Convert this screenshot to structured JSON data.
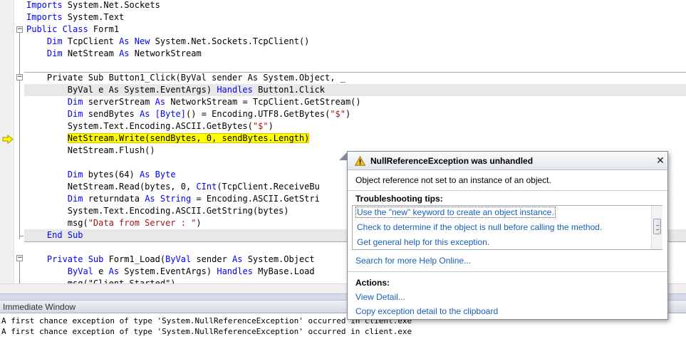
{
  "editor": {
    "lines": [
      [
        {
          "t": "Imports",
          "k": "kw"
        },
        {
          "t": " System.Net.Sockets"
        }
      ],
      [
        {
          "t": "Imports",
          "k": "kw"
        },
        {
          "t": " System.Text"
        }
      ],
      [
        {
          "t": "Public Class",
          "k": "kw"
        },
        {
          "t": " Form1"
        }
      ],
      [
        {
          "t": "    "
        },
        {
          "t": "Dim",
          "k": "kw"
        },
        {
          "t": " TcpClient "
        },
        {
          "t": "As New",
          "k": "kw"
        },
        {
          "t": " System.Net.Sockets.TcpClient()"
        }
      ],
      [
        {
          "t": "    "
        },
        {
          "t": "Dim",
          "k": "kw"
        },
        {
          "t": " NetStream "
        },
        {
          "t": "As",
          "k": "kw"
        },
        {
          "t": " NetworkStream"
        }
      ],
      [],
      [
        {
          "t": "    Private Sub Button1_Click(ByVal sender As System.Object, _"
        }
      ],
      [
        {
          "t": "        ByVal e As System.EventArgs) "
        },
        {
          "t": "Handles",
          "k": "kw"
        },
        {
          "t": " Button1.Click"
        }
      ],
      [
        {
          "t": "        "
        },
        {
          "t": "Dim",
          "k": "kw"
        },
        {
          "t": " serverStream "
        },
        {
          "t": "As",
          "k": "kw"
        },
        {
          "t": " NetworkStream = TcpClient.GetStream()"
        }
      ],
      [
        {
          "t": "        "
        },
        {
          "t": "Dim",
          "k": "kw"
        },
        {
          "t": " sendBytes "
        },
        {
          "t": "As",
          "k": "kw"
        },
        {
          "t": " "
        },
        {
          "t": "[Byte]",
          "k": "kw"
        },
        {
          "t": "() = Encoding.UTF8.GetBytes("
        },
        {
          "t": "\"$\"",
          "k": "st"
        },
        {
          "t": ")"
        }
      ],
      [
        {
          "t": "        System.Text.Encoding.ASCII.GetBytes("
        },
        {
          "t": "\"$\"",
          "k": "st"
        },
        {
          "t": ")"
        }
      ],
      [
        {
          "t": "        "
        },
        {
          "t": "NetStream.Write(sendBytes, 0, sendBytes.Length)",
          "k": "hl"
        }
      ],
      [
        {
          "t": "        NetStream.Flush()"
        }
      ],
      [],
      [
        {
          "t": "        "
        },
        {
          "t": "Dim",
          "k": "kw"
        },
        {
          "t": " bytes(64) "
        },
        {
          "t": "As Byte",
          "k": "kw"
        }
      ],
      [
        {
          "t": "        NetStream.Read(bytes, 0, "
        },
        {
          "t": "CInt",
          "k": "kw"
        },
        {
          "t": "(TcpClient.ReceiveBu"
        }
      ],
      [
        {
          "t": "        "
        },
        {
          "t": "Dim",
          "k": "kw"
        },
        {
          "t": " returndata "
        },
        {
          "t": "As String",
          "k": "kw"
        },
        {
          "t": " = Encoding.ASCII.GetStri"
        }
      ],
      [
        {
          "t": "        System.Text.Encoding.ASCII.GetString(bytes)"
        }
      ],
      [
        {
          "t": "        msg("
        },
        {
          "t": "\"Data from Server : \"",
          "k": "st"
        },
        {
          "t": ")"
        }
      ],
      [
        {
          "t": "    "
        },
        {
          "t": "End Sub",
          "k": "kw"
        }
      ],
      [],
      [
        {
          "t": "    "
        },
        {
          "t": "Private Sub",
          "k": "kw"
        },
        {
          "t": " Form1_Load("
        },
        {
          "t": "ByVal",
          "k": "kw"
        },
        {
          "t": " sender "
        },
        {
          "t": "As",
          "k": "kw"
        },
        {
          "t": " System.Object"
        }
      ],
      [
        {
          "t": "        "
        },
        {
          "t": "ByVal",
          "k": "kw"
        },
        {
          "t": " e "
        },
        {
          "t": "As",
          "k": "kw"
        },
        {
          "t": " System.EventArgs) "
        },
        {
          "t": "Handles",
          "k": "kw"
        },
        {
          "t": " MyBase.Load"
        }
      ],
      [
        {
          "t": "        msg(\"Client Started\")"
        }
      ]
    ]
  },
  "exception_helper": {
    "title": "NullReferenceException was unhandled",
    "message": "Object reference not set to an instance of an object.",
    "tips_header": "Troubleshooting tips:",
    "tips": [
      "Use the \"new\" keyword to create an object instance.",
      "Check to determine if the object is null before calling the method.",
      "Get general help for this exception."
    ],
    "help_link": "Search for more Help Online...",
    "actions_header": "Actions:",
    "actions": [
      "View Detail...",
      "Copy exception detail to the clipboard"
    ],
    "close_glyph": "✕",
    "icon": "warning-icon"
  },
  "immediate_window": {
    "title": "Immediate Window",
    "output": [
      "A first chance exception of type 'System.NullReferenceException' occurred in client.exe",
      "A first chance exception of type 'System.NullReferenceException' occurred in client.exe"
    ]
  },
  "colors": {
    "keyword": "#0000ff",
    "string": "#a31515",
    "current_statement": "#ffff00",
    "link": "#1a5fb4"
  }
}
